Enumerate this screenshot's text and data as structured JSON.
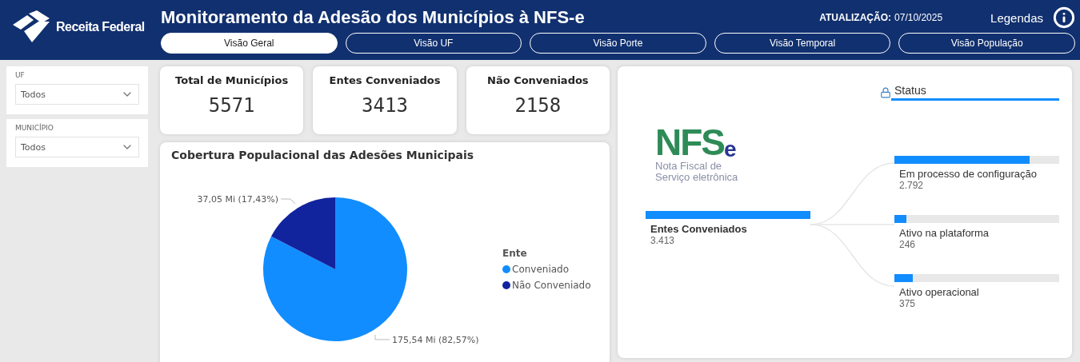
{
  "header": {
    "brand": "Receita Federal",
    "title": "Monitoramento da Adesão dos Municípios à NFS-e",
    "update_label": "ATUALIZAÇÃO:",
    "update_date": "07/10/2025",
    "legend_link": "Legendas"
  },
  "tabs": [
    {
      "label": "Visão Geral",
      "selected": true
    },
    {
      "label": "Visão UF",
      "selected": false
    },
    {
      "label": "Visão Porte",
      "selected": false
    },
    {
      "label": "Visão Temporal",
      "selected": false
    },
    {
      "label": "Visão População",
      "selected": false
    }
  ],
  "filters": [
    {
      "label": "UF",
      "value": "Todos"
    },
    {
      "label": "MUNICÍPIO",
      "value": "Todos"
    }
  ],
  "kpis": [
    {
      "label": "Total de Municípios",
      "value": "5571"
    },
    {
      "label": "Entes Conveniados",
      "value": "3413"
    },
    {
      "label": "Não Conveniados",
      "value": "2158"
    }
  ],
  "coverage": {
    "title": "Cobertura Populacional das Adesões Municipais",
    "legend_title": "Ente",
    "chart_data": {
      "type": "pie",
      "categories": [
        "Conveniado",
        "Não Conveniado"
      ],
      "values": [
        82.57,
        17.43
      ],
      "colors": [
        "#118dff",
        "#12239e"
      ],
      "data_labels": true,
      "value_labels": [
        "175,54 Mi (82,57%)",
        "37,05 Mi (17,43%)"
      ]
    }
  },
  "status_tree": {
    "logo": {
      "mark": "NFS",
      "suffix": "e",
      "subtitle": [
        "Nota Fiscal de",
        "Serviço eletrônica"
      ]
    },
    "header": "Status",
    "root": {
      "label": "Entes Conveniados",
      "value": "3.413"
    },
    "children": [
      {
        "label": "Em processo de configuração",
        "value": "2.792",
        "level": 0.818
      },
      {
        "label": "Ativo na plataforma",
        "value": "246",
        "level": 0.072
      },
      {
        "label": "Ativo operacional",
        "value": "375",
        "level": 0.11
      }
    ]
  }
}
